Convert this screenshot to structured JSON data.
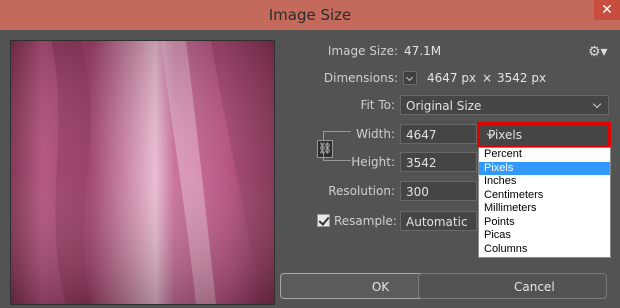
{
  "window": {
    "title": "Image Size",
    "close_symbol": "✕"
  },
  "info": {
    "image_size_label": "Image Size:",
    "image_size_value": "47.1M",
    "dimensions_label": "Dimensions:",
    "dim_width": "4647 px",
    "dim_x": "×",
    "dim_height": "3542 px"
  },
  "fit_to": {
    "label": "Fit To:",
    "value": "Original Size"
  },
  "width": {
    "label": "Width:",
    "value": "4647"
  },
  "height": {
    "label": "Height:",
    "value": "3542"
  },
  "resolution": {
    "label": "Resolution:",
    "value": "300"
  },
  "resample": {
    "label": "Resample:",
    "value": "Automatic",
    "checked": true
  },
  "units": {
    "selected": "Pixels",
    "options": [
      "Percent",
      "Pixels",
      "Inches",
      "Centimeters",
      "Millimeters",
      "Points",
      "Picas",
      "Columns"
    ],
    "highlighted_index": 1
  },
  "buttons": {
    "ok": "OK",
    "cancel": "Cancel"
  },
  "colors": {
    "titlebar": "#c46a5d",
    "dialog_bg": "#535353",
    "highlight_box": "#e00000",
    "menu_selected": "#3399ff",
    "preview_fabric": "#b8567e"
  }
}
